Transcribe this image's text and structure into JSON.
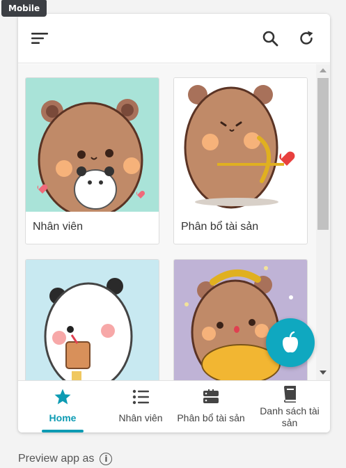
{
  "badge": {
    "label": "Mobile"
  },
  "topbar": {
    "menu_icon": "menu-icon",
    "search_icon": "search-icon",
    "refresh_icon": "refresh-icon"
  },
  "cards": [
    {
      "label": "Nhân viên",
      "bg": "#a9e3d8",
      "image": "bear-holding-panda-illustration"
    },
    {
      "label": "Phân bổ tài sản",
      "bg": "#ffffff",
      "image": "bear-cupid-arrow-illustration"
    },
    {
      "label": "",
      "bg": "#c8e9f1",
      "image": "panda-with-drink-illustration"
    },
    {
      "label": "",
      "bg": "#bfb3d6",
      "image": "bear-with-pumpkin-illustration"
    }
  ],
  "fab": {
    "icon": "apple-icon",
    "color": "#0fa8c0"
  },
  "bottom_nav": [
    {
      "label": "Home",
      "icon": "star-icon",
      "active": true
    },
    {
      "label": "Nhân viên",
      "icon": "list-icon",
      "active": false
    },
    {
      "label": "Phân bổ tài sản",
      "icon": "server-icon",
      "active": false
    },
    {
      "label": "Danh sách tài sản",
      "icon": "book-icon",
      "active": false
    }
  ],
  "footer": {
    "text": "Preview app as",
    "info_glyph": "i"
  },
  "colors": {
    "accent": "#0d9bb3",
    "bear_brown": "#c08a68",
    "heart": "#f06a7a"
  }
}
